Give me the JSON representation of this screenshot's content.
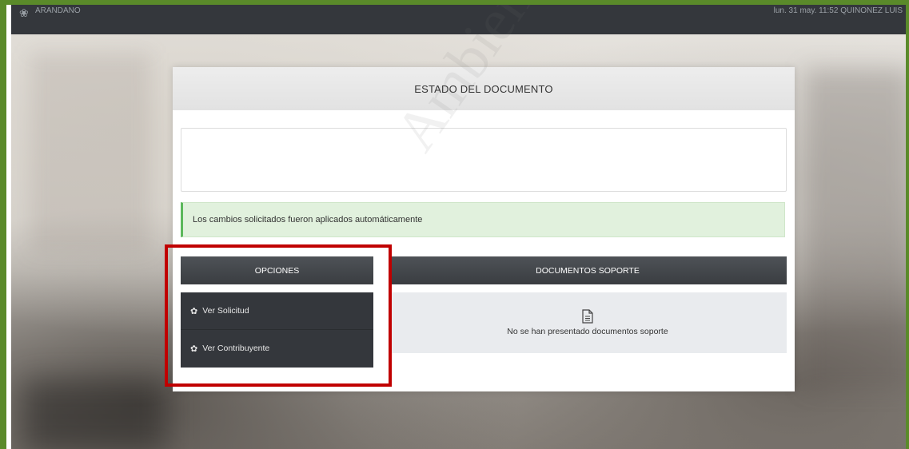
{
  "topbar": {
    "brand": "ARANDANO",
    "right_info": "lun. 31 may. 11:52   QUINONEZ LUIS"
  },
  "card": {
    "title": "ESTADO DEL DOCUMENTO",
    "alert": "Los cambios solicitados fueron aplicados automáticamente"
  },
  "options": {
    "header": "OPCIONES",
    "items": [
      {
        "label": "Ver Solicitud",
        "icon": "gear-icon"
      },
      {
        "label": "Ver Contribuyente",
        "icon": "gear-icon"
      }
    ]
  },
  "documents": {
    "header": "DOCUMENTOS SOPORTE",
    "empty_text": "No se han presentado documentos soporte",
    "icon": "document-icon"
  },
  "watermark": "Ambiente de Pruebas",
  "colors": {
    "frame": "#5a8a2a",
    "highlight": "#c00000",
    "topbar": "#34373c",
    "alert_bg": "#e1f1dd",
    "alert_border": "#5cb85c"
  }
}
